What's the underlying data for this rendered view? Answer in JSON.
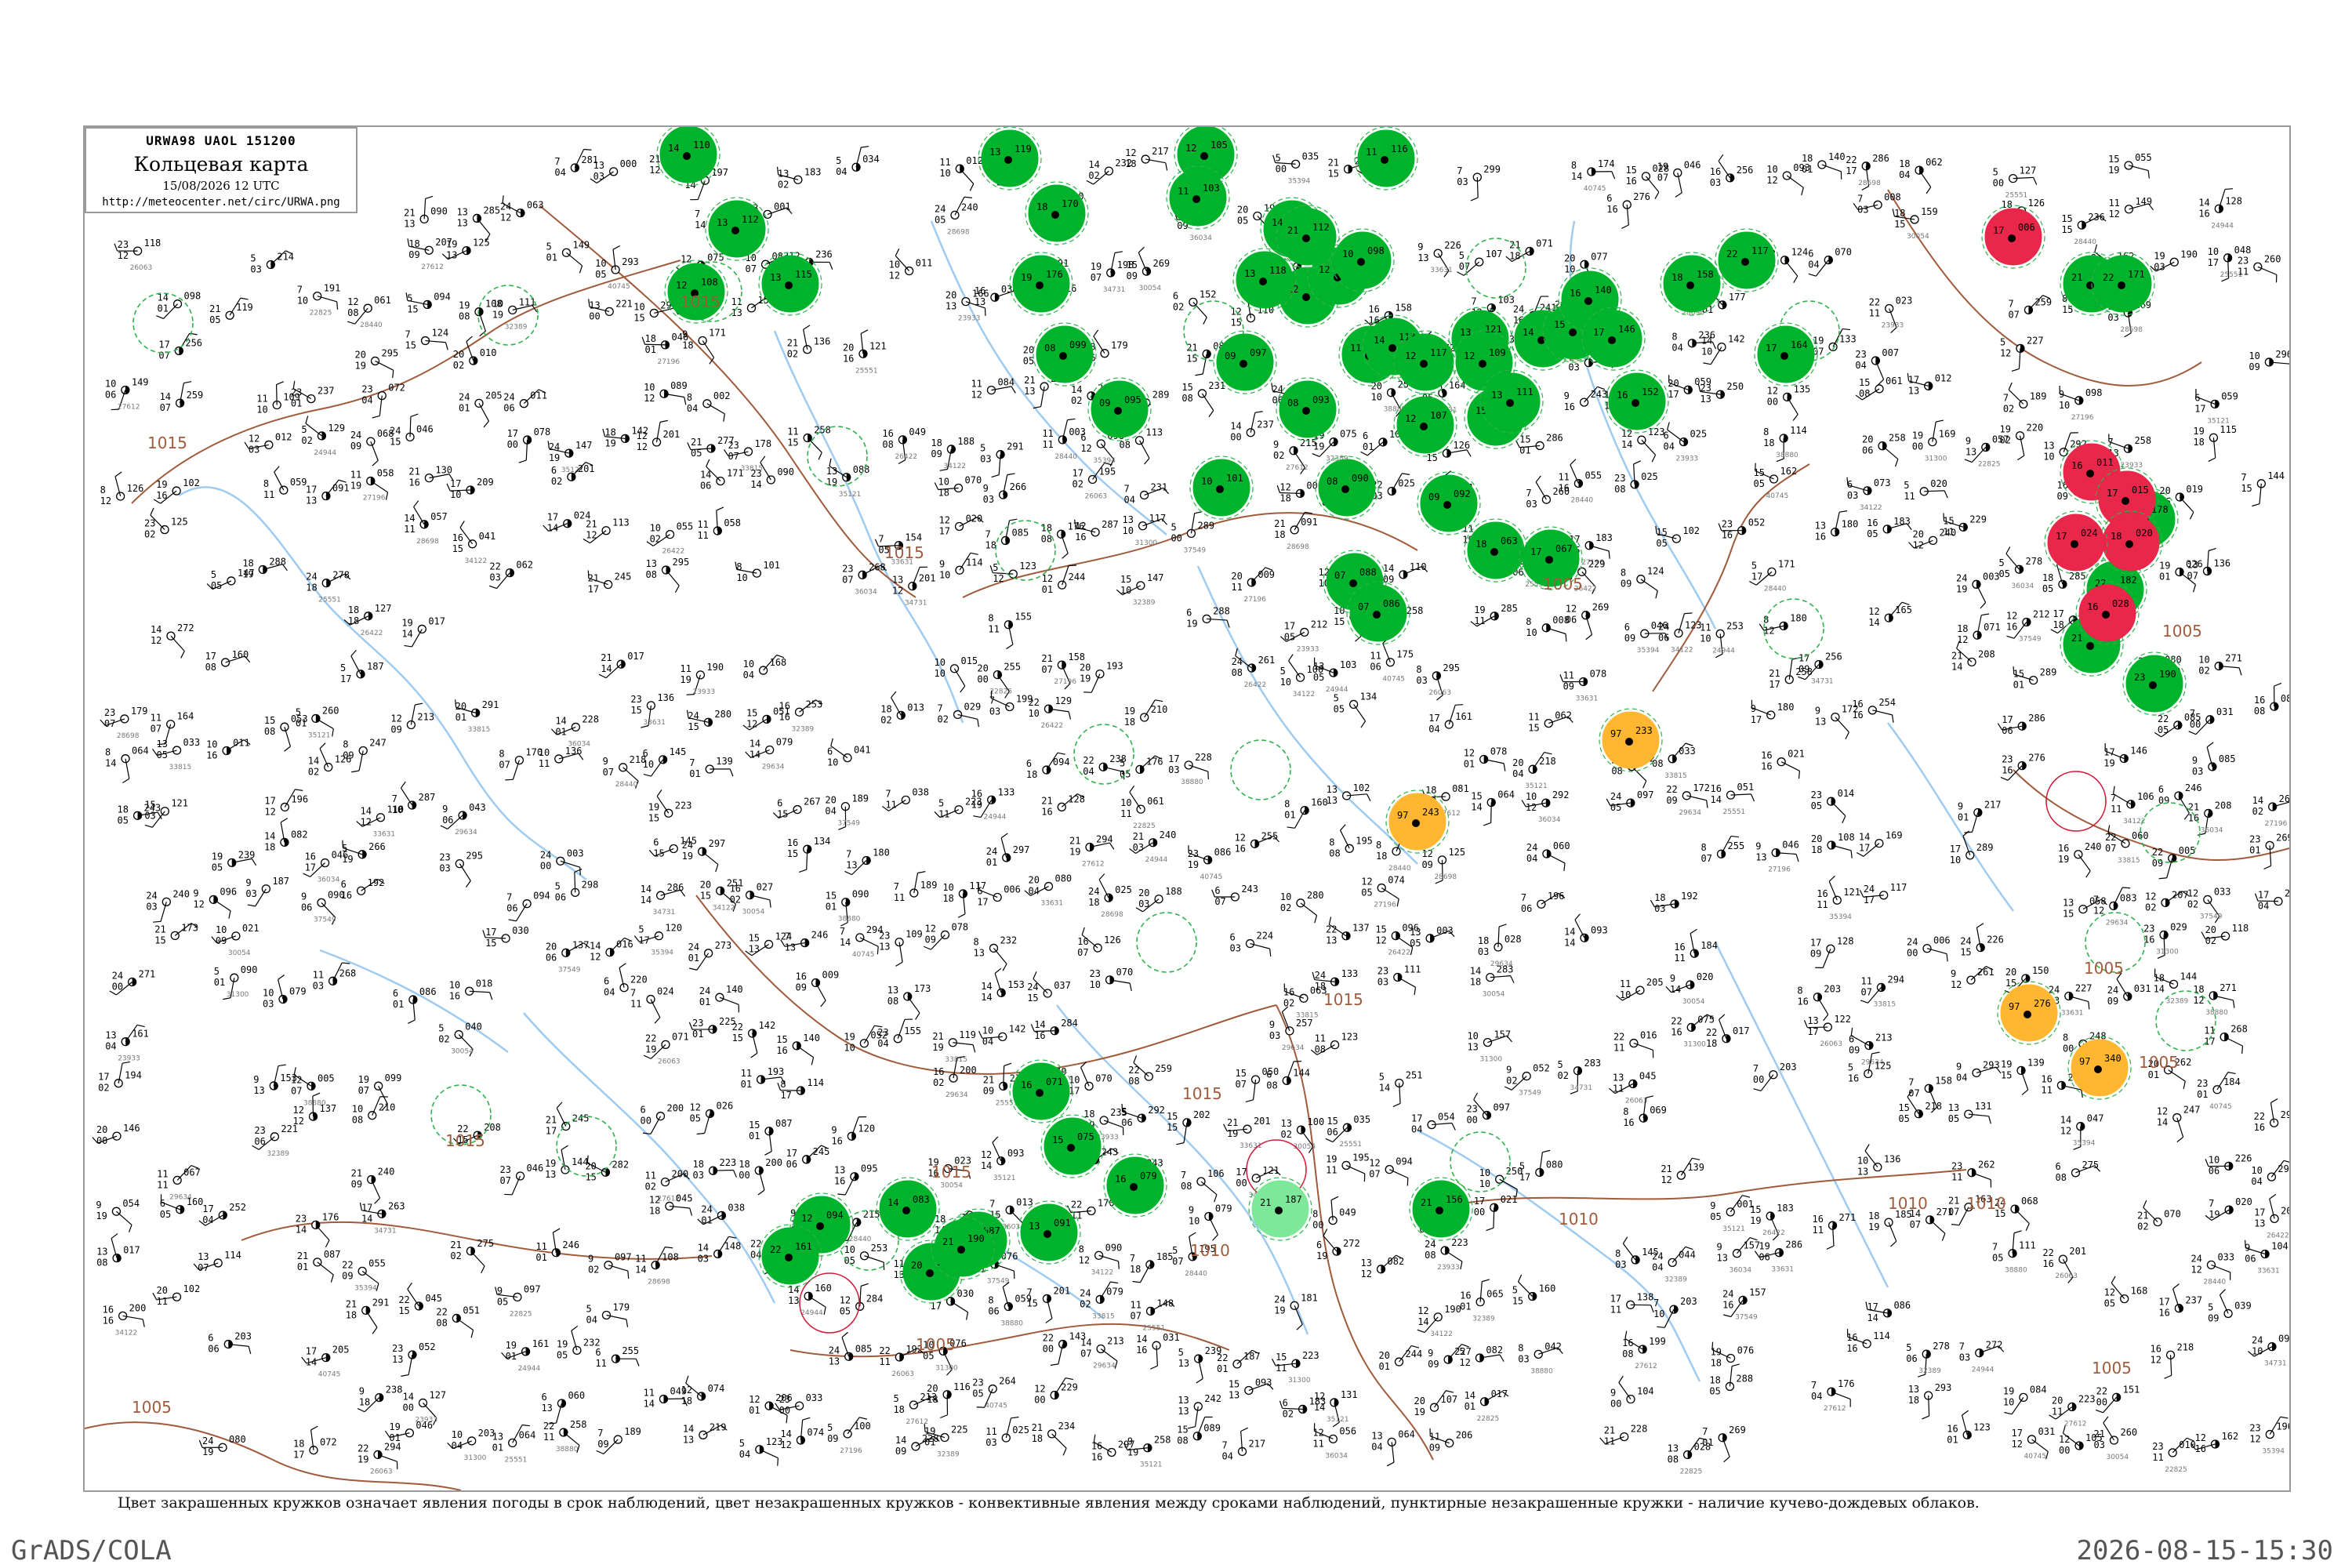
{
  "header": {
    "map_code": "URWA98 UAOL 151200",
    "title": "Кольцевая карта",
    "date": "15/08/2026 12 UTC",
    "url": "http://meteocenter.net/circ/URWA.png"
  },
  "legend_note": "Цвет закрашенных кружков означает явления погоды в срок наблюдений, цвет незакрашенных кружков - конвективные явления между сроками наблюдений, пунктирные незакрашенные кружки - наличие кучево-дождевых облаков.",
  "footer": {
    "software": "GrADS/COLA",
    "timestamp": "2026-08-15-15:30"
  },
  "colors": {
    "precipitation": "#00b32c",
    "drizzle": "#7ee89a",
    "thunderstorm": "#e8274b",
    "haze": "#ffb732",
    "isobar": "#a05a3c",
    "river": "#9ecbef",
    "convective_ring": "#2fb34a",
    "thunder_ring": "#d01b3a"
  },
  "isobar_labels": [
    "1015",
    "1015",
    "1015",
    "1015",
    "1015",
    "1015",
    "1015",
    "1010",
    "1010",
    "1010",
    "1010",
    "1005",
    "1005",
    "1005",
    "1005",
    "1005",
    "1005",
    "1005"
  ],
  "stations": [
    {
      "p": "110",
      "t": "14",
      "w": "rain"
    },
    {
      "p": "112",
      "t": "13",
      "w": "rain"
    },
    {
      "p": "108",
      "t": "12",
      "w": "rain"
    },
    {
      "p": "115",
      "t": "13",
      "w": "rain"
    },
    {
      "p": "119",
      "t": "13",
      "w": "rain"
    },
    {
      "p": "105",
      "t": "12",
      "w": "rain"
    },
    {
      "p": "103",
      "t": "11",
      "w": "rain"
    },
    {
      "p": "125",
      "t": "14",
      "w": "rain"
    },
    {
      "p": "130",
      "t": "12",
      "w": "rain"
    },
    {
      "p": "118",
      "t": "13",
      "w": "rain"
    },
    {
      "p": "116",
      "t": "11",
      "w": "rain"
    },
    {
      "p": "120",
      "t": "12",
      "w": "rain"
    },
    {
      "p": "098",
      "t": "10",
      "w": "rain"
    },
    {
      "p": "104",
      "t": "11",
      "w": "rain"
    },
    {
      "p": "113",
      "t": "14",
      "w": "rain"
    },
    {
      "p": "117",
      "t": "12",
      "w": "rain"
    },
    {
      "p": "121",
      "t": "13",
      "w": "rain"
    },
    {
      "p": "109",
      "t": "12",
      "w": "rain"
    },
    {
      "p": "122",
      "t": "15",
      "w": "rain"
    },
    {
      "p": "111",
      "t": "13",
      "w": "rain"
    },
    {
      "p": "107",
      "t": "12",
      "w": "rain"
    },
    {
      "p": "129",
      "t": "14",
      "w": "rain"
    },
    {
      "p": "134",
      "t": "15",
      "w": "rain"
    },
    {
      "p": "140",
      "t": "16",
      "w": "rain"
    },
    {
      "p": "146",
      "t": "17",
      "w": "rain"
    },
    {
      "p": "152",
      "t": "16",
      "w": "rain"
    },
    {
      "p": "158",
      "t": "18",
      "w": "rain"
    },
    {
      "p": "164",
      "t": "17",
      "w": "rain"
    },
    {
      "p": "170",
      "t": "18",
      "w": "rain"
    },
    {
      "p": "176",
      "t": "19",
      "w": "rain"
    },
    {
      "p": "099",
      "t": "08",
      "w": "rain"
    },
    {
      "p": "095",
      "t": "09",
      "w": "rain"
    },
    {
      "p": "101",
      "t": "10",
      "w": "rain"
    },
    {
      "p": "097",
      "t": "09",
      "w": "rain"
    },
    {
      "p": "093",
      "t": "08",
      "w": "rain"
    },
    {
      "p": "088",
      "t": "07",
      "w": "rain"
    },
    {
      "p": "090",
      "t": "08",
      "w": "rain"
    },
    {
      "p": "086",
      "t": "07",
      "w": "rain"
    },
    {
      "p": "092",
      "t": "09",
      "w": "rain"
    },
    {
      "p": "063",
      "t": "18",
      "w": "rain"
    },
    {
      "p": "067",
      "t": "17",
      "w": "rain"
    },
    {
      "p": "071",
      "t": "16",
      "w": "rain"
    },
    {
      "p": "075",
      "t": "15",
      "w": "rain"
    },
    {
      "p": "079",
      "t": "16",
      "w": "rain"
    },
    {
      "p": "083",
      "t": "14",
      "w": "rain"
    },
    {
      "p": "087",
      "t": "15",
      "w": "rain"
    },
    {
      "p": "091",
      "t": "13",
      "w": "rain"
    },
    {
      "p": "094",
      "t": "12",
      "w": "rain"
    },
    {
      "p": "149",
      "t": "20",
      "w": "rain"
    },
    {
      "p": "156",
      "t": "21",
      "w": "rain"
    },
    {
      "p": "161",
      "t": "22",
      "w": "rain"
    },
    {
      "p": "166",
      "t": "21",
      "w": "rain"
    },
    {
      "p": "171",
      "t": "22",
      "w": "rain"
    },
    {
      "p": "178",
      "t": "20",
      "w": "rain"
    },
    {
      "p": "182",
      "t": "22",
      "w": "rain"
    },
    {
      "p": "187",
      "t": "21",
      "w": "rain"
    },
    {
      "p": "190",
      "t": "23",
      "w": "rain"
    },
    {
      "p": "190",
      "t": "21",
      "w": "rain"
    },
    {
      "p": "117",
      "t": "22",
      "w": "rain"
    },
    {
      "p": "112",
      "t": "21",
      "w": "rain"
    },
    {
      "p": "006",
      "t": "17",
      "w": "storm"
    },
    {
      "p": "011",
      "t": "16",
      "w": "storm"
    },
    {
      "p": "015",
      "t": "17",
      "w": "storm"
    },
    {
      "p": "020",
      "t": "18",
      "w": "storm"
    },
    {
      "p": "024",
      "t": "17",
      "w": "storm"
    },
    {
      "p": "028",
      "t": "16",
      "w": "storm"
    },
    {
      "p": "233",
      "t": "97",
      "w": "haze"
    },
    {
      "p": "243",
      "t": "97",
      "w": "haze"
    },
    {
      "p": "276",
      "t": "97",
      "w": "haze"
    },
    {
      "p": "340",
      "t": "97",
      "w": "haze"
    },
    {
      "p": "187",
      "t": "21",
      "w": "drizzle"
    }
  ],
  "station_codes": [
    "26063",
    "27612",
    "28698",
    "23933",
    "34122",
    "33815",
    "29634",
    "30054",
    "31300",
    "32389",
    "22825",
    "24944",
    "25551",
    "35121",
    "36034",
    "37549",
    "38880",
    "40745",
    "28440",
    "27196",
    "26422",
    "33631",
    "34731",
    "35394"
  ]
}
